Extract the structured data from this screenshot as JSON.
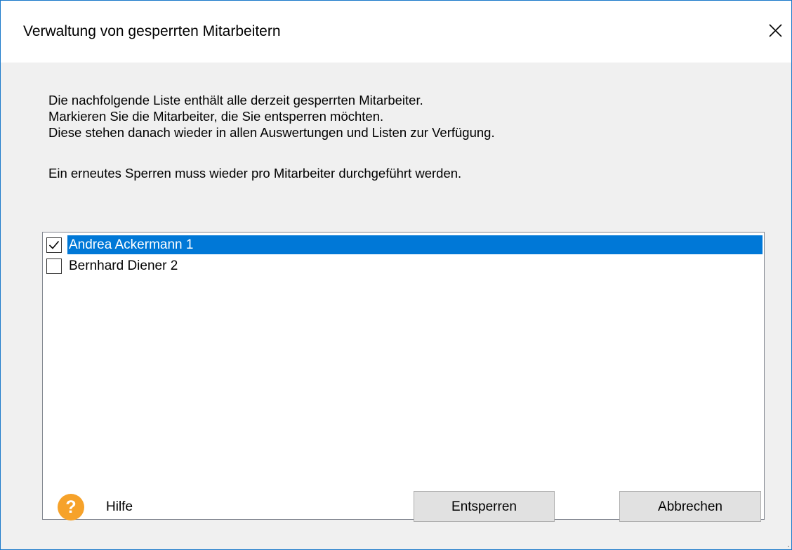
{
  "window": {
    "title": "Verwaltung von gesperrten Mitarbeitern"
  },
  "description": {
    "lines": [
      "Die nachfolgende Liste enthält alle derzeit gesperrten Mitarbeiter.",
      "Markieren Sie die Mitarbeiter, die Sie entsperren möchten.",
      "Diese stehen danach wieder in allen Auswertungen und Listen zur Verfügung."
    ],
    "note": "Ein erneutes Sperren muss wieder pro Mitarbeiter durchgeführt werden."
  },
  "employees": [
    {
      "label": "Andrea Ackermann 1",
      "checked": true,
      "selected": true
    },
    {
      "label": "Bernhard Diener 2",
      "checked": false,
      "selected": false
    }
  ],
  "footer": {
    "help_label": "Hilfe",
    "unlock_button": "Entsperren",
    "cancel_button": "Abbrechen"
  },
  "colors": {
    "selection": "#0078d7",
    "help_icon": "#f6a22a",
    "window_border": "#1979ca"
  },
  "icons": {
    "close": "close-icon",
    "help": "help-icon",
    "check": "checkmark-icon"
  }
}
